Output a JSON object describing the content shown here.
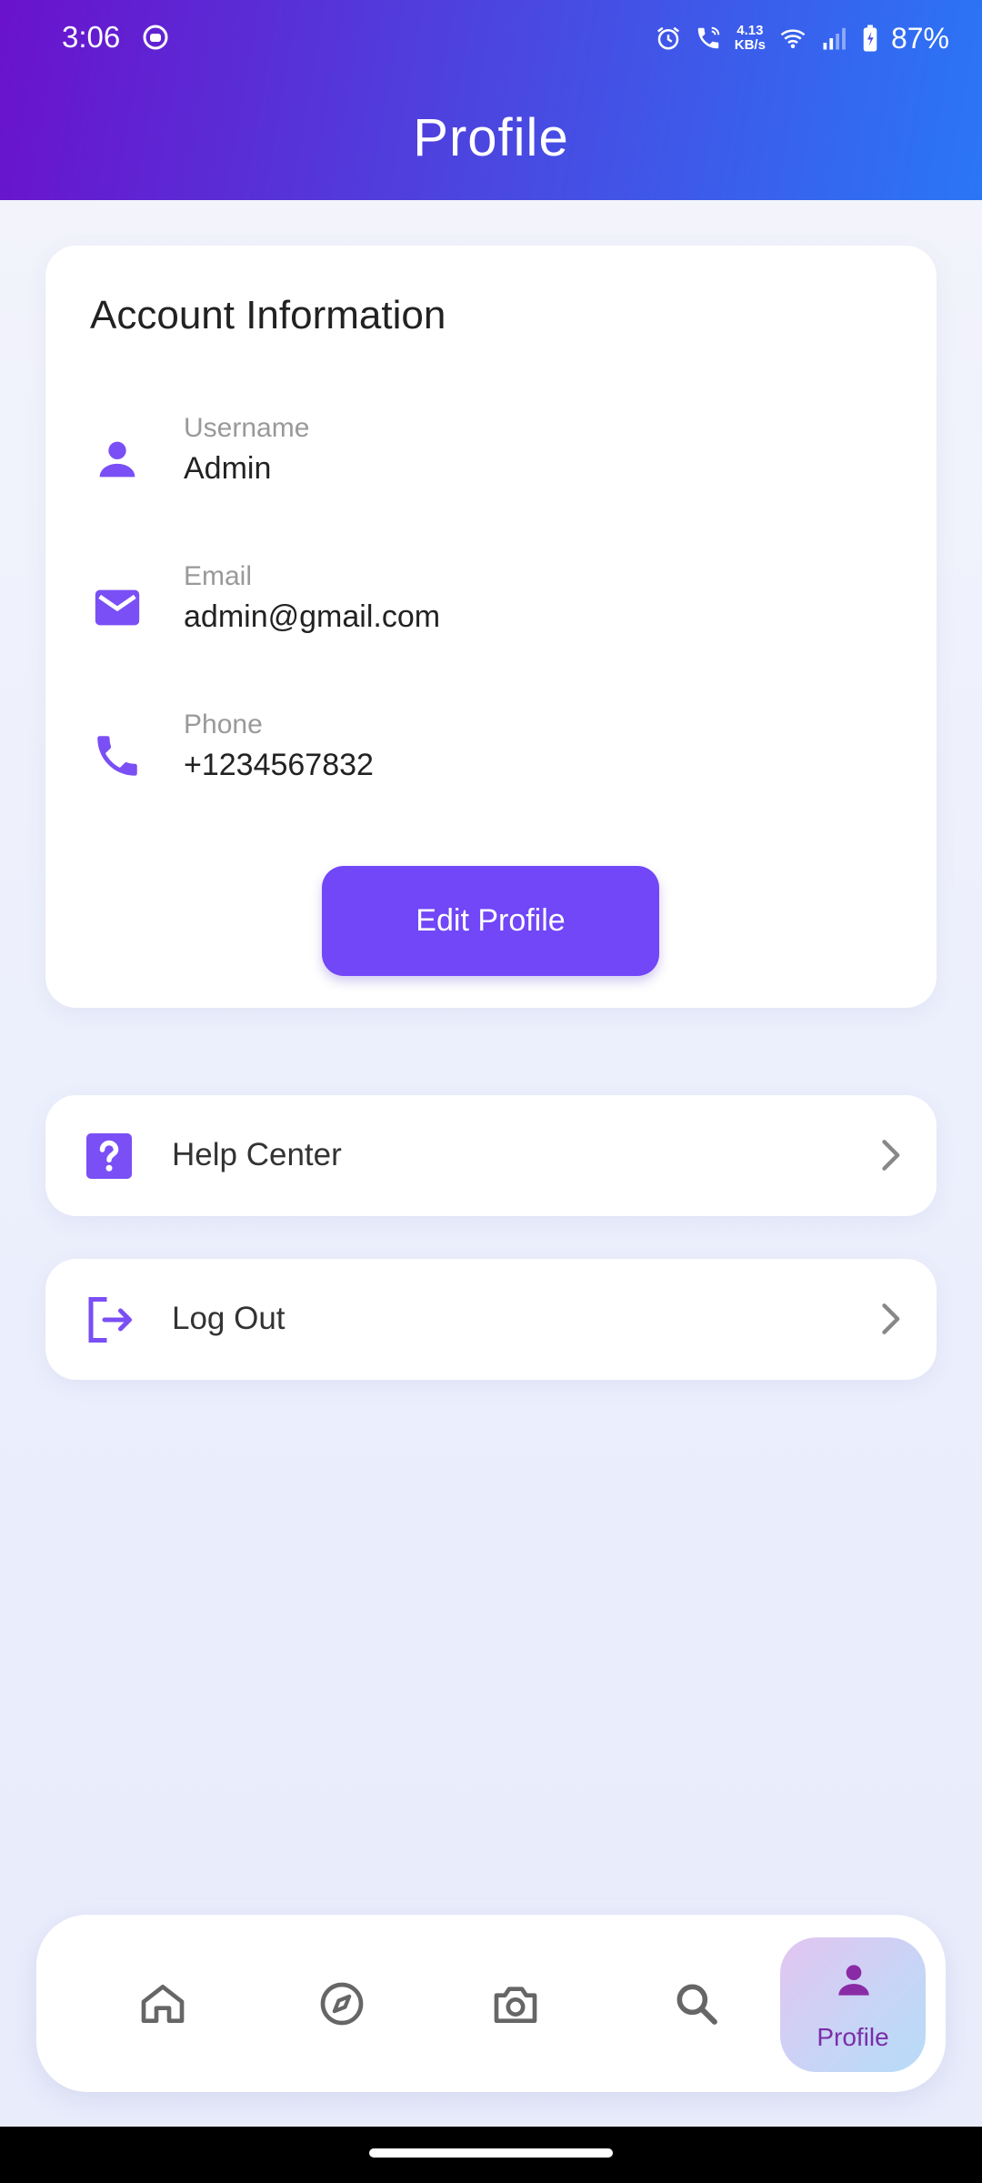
{
  "status_bar": {
    "time": "3:06",
    "speed_top": "4.13",
    "speed_bottom": "KB/s",
    "battery": "87%",
    "icons": [
      "app-notification-icon",
      "alarm-icon",
      "wifi-call-icon",
      "wifi-icon",
      "signal-icon",
      "battery-charging-icon"
    ]
  },
  "header": {
    "title": "Profile"
  },
  "account": {
    "title": "Account Information",
    "fields": [
      {
        "label": "Username",
        "value": "Admin",
        "icon": "person-icon"
      },
      {
        "label": "Email",
        "value": "admin@gmail.com",
        "icon": "email-icon"
      },
      {
        "label": "Phone",
        "value": "+1234567832",
        "icon": "phone-icon"
      }
    ],
    "edit_button": "Edit Profile"
  },
  "menu": [
    {
      "label": "Help Center",
      "icon": "help-icon"
    },
    {
      "label": "Log Out",
      "icon": "logout-icon"
    }
  ],
  "bottom_nav": {
    "items": [
      "home-icon",
      "explore-icon",
      "camera-icon",
      "search-icon",
      "profile-icon"
    ],
    "active_label": "Profile"
  },
  "colors": {
    "accent": "#7147f7",
    "icon_purple": "#7a4ff5",
    "header_start": "#6a12cc",
    "header_end": "#2a76f7",
    "active_nav_text": "#7a2ea8"
  }
}
